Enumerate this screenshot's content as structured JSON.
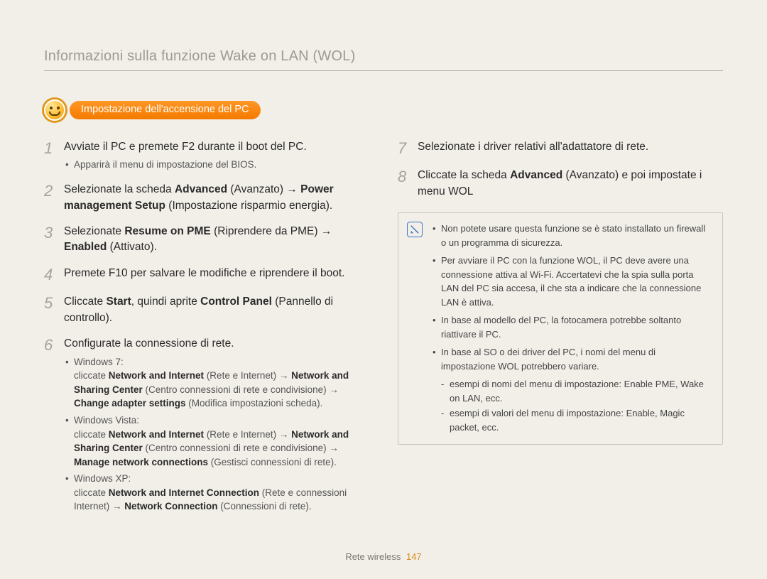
{
  "header": {
    "title": "Informazioni sulla funzione Wake on LAN (WOL)"
  },
  "capsule": {
    "label": "Impostazione dell'accensione del PC"
  },
  "left": {
    "s1": {
      "text": "Avviate il PC e premete F2 durante il boot del PC.",
      "sub1": "Apparirà il menu di impostazione del BIOS."
    },
    "s2": {
      "pre": "Selezionate la scheda ",
      "b1": "Advanced",
      "mid1": " (Avanzato) → ",
      "b2": "Power management Setup",
      "post": " (Impostazione risparmio energia)."
    },
    "s3": {
      "pre": "Selezionate ",
      "b1": "Resume on PME",
      "mid1": " (Riprendere da PME) → ",
      "b2": "Enabled",
      "post": " (Attivato)."
    },
    "s4": {
      "text": "Premete F10 per salvare le modifiche e riprendere il boot."
    },
    "s5": {
      "pre": "Cliccate ",
      "b1": "Start",
      "mid1": ", quindi aprite ",
      "b2": "Control Panel",
      "post": " (Pannello di controllo)."
    },
    "s6": {
      "text": "Configurate la connessione di rete.",
      "w7": {
        "head": "Windows 7:",
        "line1a": "cliccate ",
        "b1": "Network and Internet",
        "line1b": " (Rete e Internet) →",
        "b2": "Network and Sharing Center",
        "line2b": " (Centro connessioni di rete e condivisione) → ",
        "b3": "Change adapter settings",
        "line3b": " (Modifica impostazioni scheda)."
      },
      "wv": {
        "head": "Windows Vista:",
        "line1a": "cliccate ",
        "b1": "Network and Internet",
        "line1b": " (Rete e Internet) →",
        "b2": "Network and Sharing Center",
        "line2b": " (Centro connessioni di rete e condivisione) → ",
        "b3": "Manage network connections",
        "line3b": " (Gestisci connessioni di rete)."
      },
      "wxp": {
        "head": "Windows XP:",
        "line1a": "cliccate ",
        "b1": "Network and Internet Connection",
        "line1b": " (Rete e connessioni Internet) → ",
        "b2": "Network Connection",
        "line2b": " (Connessioni di rete)."
      }
    }
  },
  "right": {
    "s7": {
      "text": "Selezionate i driver relativi all'adattatore di rete."
    },
    "s8": {
      "pre": "Cliccate la scheda ",
      "b1": "Advanced",
      "post": " (Avanzato) e poi impostate i menu WOL"
    },
    "notes": {
      "n1": "Non potete usare questa funzione se è stato installato un firewall o un programma di sicurezza.",
      "n2": "Per avviare il PC con la funzione WOL, il PC deve avere una connessione attiva al Wi-Fi. Accertatevi che la spia sulla porta LAN del PC sia accesa, il che sta a indicare che la connessione LAN è attiva.",
      "n3": "In base al modello del PC, la fotocamera potrebbe soltanto riattivare il PC.",
      "n4": "In base al SO o dei driver del PC, i nomi del menu di impostazione WOL potrebbero variare.",
      "n4a": "esempi di nomi del menu di impostazione: Enable PME, Wake on LAN, ecc.",
      "n4b": "esempi di valori del menu di impostazione: Enable, Magic packet, ecc."
    }
  },
  "footer": {
    "section": "Rete wireless",
    "page": "147"
  }
}
